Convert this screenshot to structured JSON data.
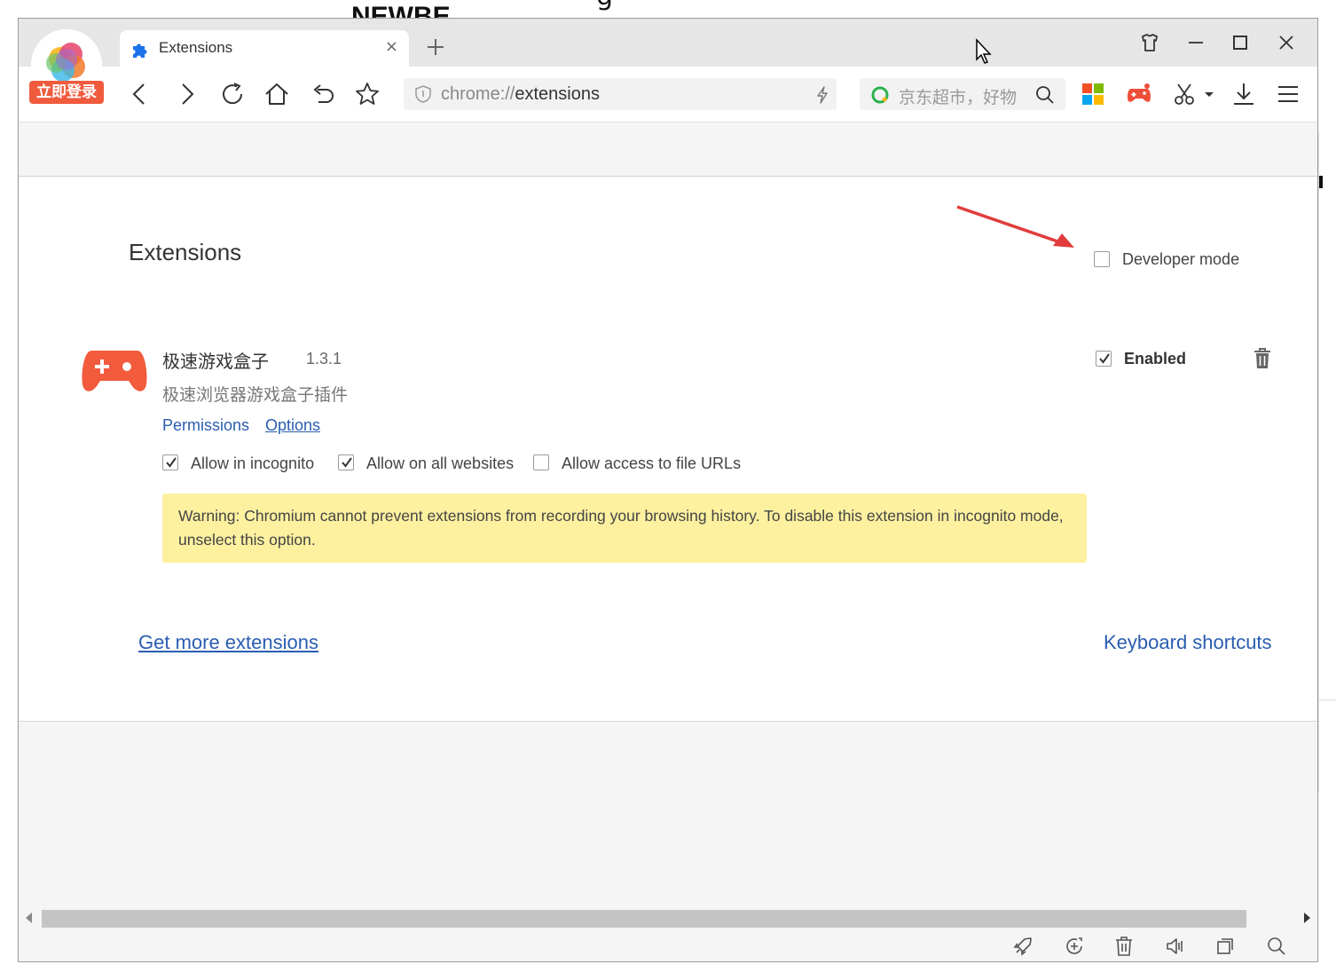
{
  "background": {
    "partial_text_left": "NEWBE",
    "partial_text_right": "g"
  },
  "tab": {
    "title": "Extensions",
    "close": "×"
  },
  "login_badge": "立即登录",
  "address_bar": {
    "scheme": "chrome://",
    "host": "extensions"
  },
  "search_bar": {
    "placeholder": "京东超市，好物"
  },
  "page": {
    "title": "Extensions",
    "developer_mode_label": "Developer mode",
    "developer_mode_checked": false
  },
  "extension": {
    "name": "极速游戏盒子",
    "version": "1.3.1",
    "description": "极速浏览器游戏盒子插件",
    "permissions_link": "Permissions",
    "options_link": "Options",
    "allow_incognito_label": "Allow in incognito",
    "allow_incognito_checked": true,
    "allow_all_sites_label": "Allow on all websites",
    "allow_all_sites_checked": true,
    "allow_file_urls_label": "Allow access to file URLs",
    "allow_file_urls_checked": false,
    "enabled_label": "Enabled",
    "enabled_checked": true,
    "warning": "Warning: Chromium cannot prevent extensions from recording your browsing history. To disable this extension in incognito mode, unselect this option."
  },
  "footer": {
    "get_more": "Get more extensions",
    "shortcuts": "Keyboard shortcuts"
  },
  "colors": {
    "link": "#2a5db0",
    "warning_bg": "#fdf1a0",
    "accent_red": "#f05a3d",
    "arrow": "#e03c3c"
  },
  "icons": [
    "puzzle-icon",
    "close-icon",
    "plus-icon",
    "skin-icon",
    "minimize-icon",
    "maximize-icon",
    "close-window-icon",
    "back-icon",
    "forward-icon",
    "reload-icon",
    "home-icon",
    "undo-icon",
    "star-icon",
    "shield-icon",
    "bolt-icon",
    "search-logo-icon",
    "search-icon",
    "apps-icon",
    "gamepad-icon",
    "scissors-icon",
    "dropdown-icon",
    "download-icon",
    "menu-icon",
    "trash-icon",
    "rocket-icon",
    "add-circle-icon",
    "delete-icon",
    "speaker-icon",
    "window-icon",
    "magnifier-icon"
  ]
}
